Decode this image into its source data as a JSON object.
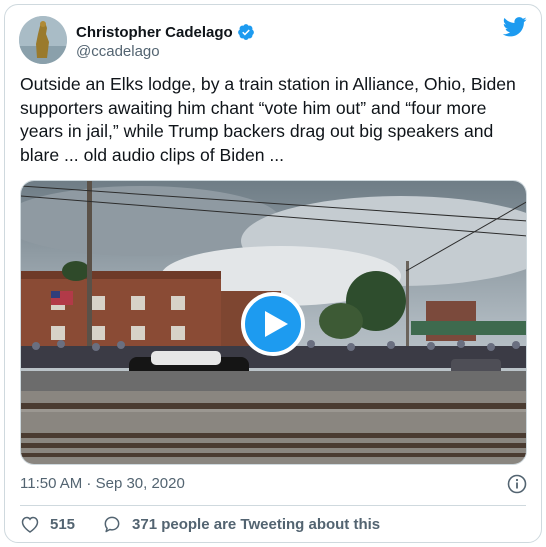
{
  "author": {
    "name": "Christopher Cadelago",
    "handle": "@ccadelago"
  },
  "tweet": {
    "text": "Outside an Elks lodge, by a train station in Alliance, Ohio, Biden supporters awaiting him chant “vote him out” and “four more years in jail,” while Trump backers drag out big speakers and blare ... old audio clips of Biden  ..."
  },
  "meta": {
    "timestamp": "11:50 AM · Sep 30, 2020"
  },
  "actions": {
    "like_count": "515",
    "reply_text": "371 people are Tweeting about this"
  },
  "icons": {
    "verified": "verified-badge-icon",
    "brand": "twitter-bird-icon",
    "play": "play-icon",
    "info": "info-icon",
    "like": "heart-icon",
    "reply": "speech-bubble-icon"
  },
  "colors": {
    "accent": "#1d9bf0",
    "text": "#0f1419",
    "secondary": "#536471",
    "border": "#cfd9de"
  }
}
